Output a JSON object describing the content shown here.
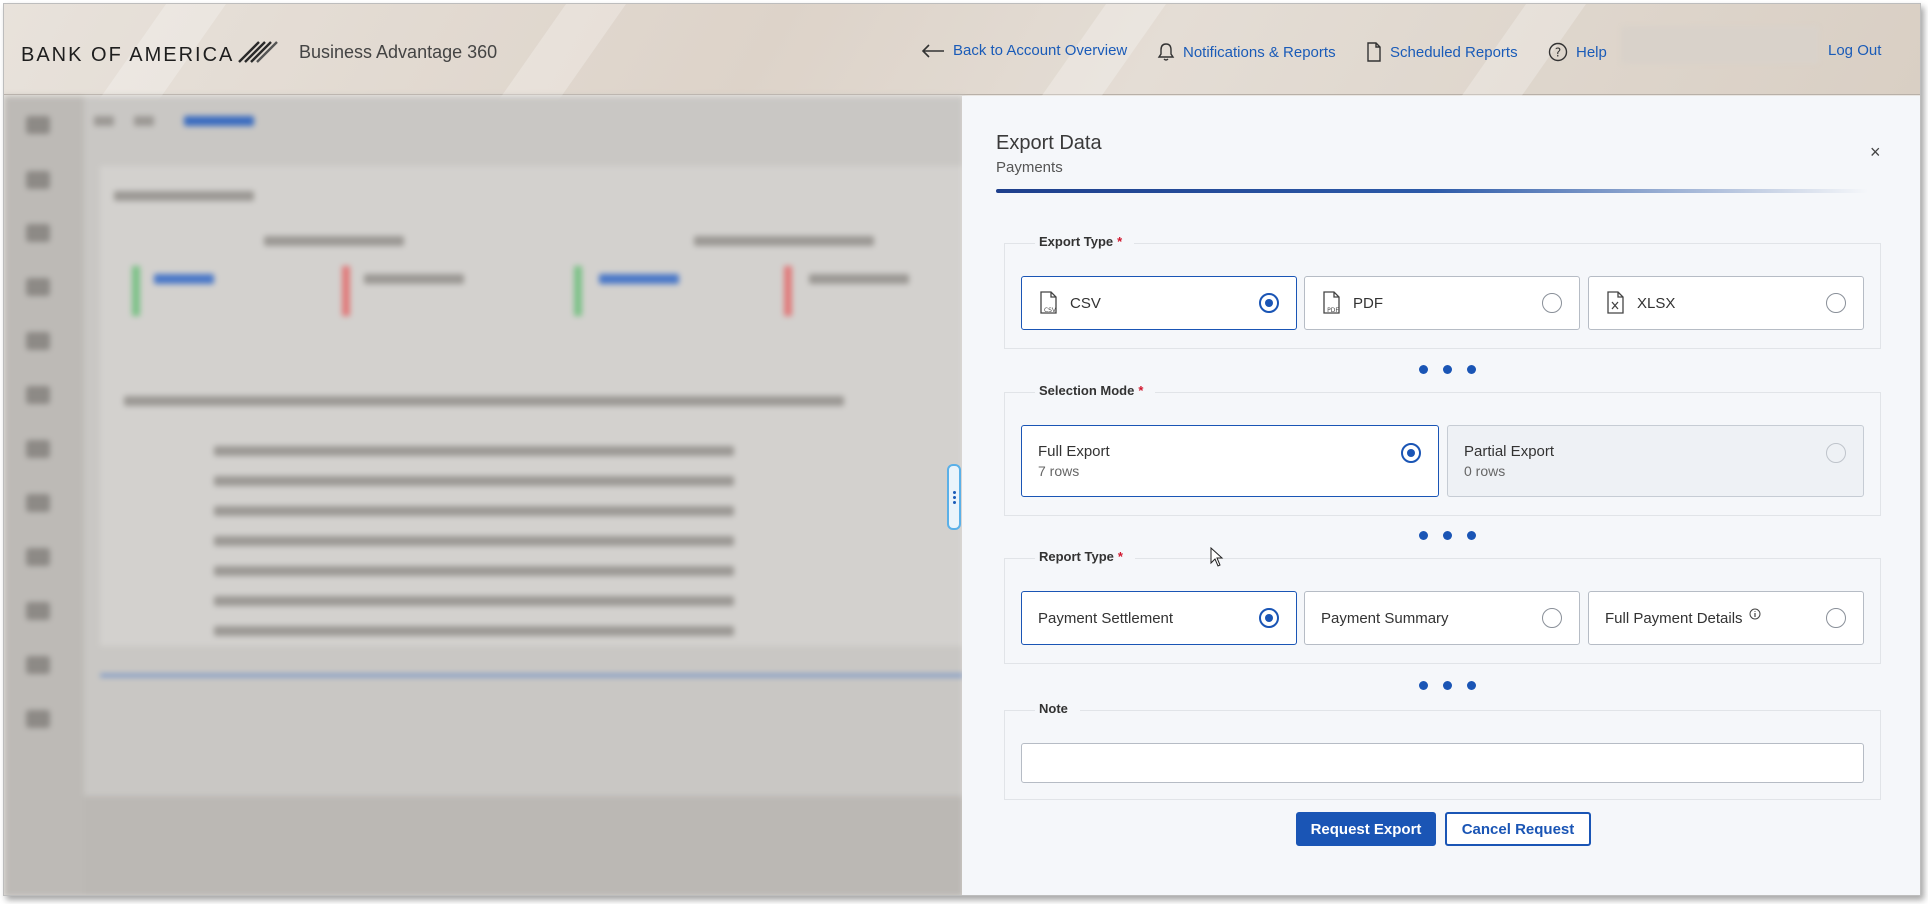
{
  "header": {
    "logo_text": "BANK OF AMERICA",
    "product_name": "Business Advantage 360",
    "nav": {
      "back": "Back to Account Overview",
      "notifications": "Notifications & Reports",
      "scheduled": "Scheduled Reports",
      "help": "Help",
      "logout": "Log Out"
    }
  },
  "drawer": {
    "title": "Export Data",
    "subtitle": "Payments",
    "close_label": "×",
    "export_type": {
      "label": "Export Type",
      "required_mark": "*",
      "options": [
        {
          "label": "CSV",
          "selected": true,
          "icon": "csv-file-icon"
        },
        {
          "label": "PDF",
          "selected": false,
          "icon": "pdf-file-icon"
        },
        {
          "label": "XLSX",
          "selected": false,
          "icon": "xlsx-file-icon"
        }
      ]
    },
    "selection_mode": {
      "label": "Selection Mode",
      "required_mark": "*",
      "options": [
        {
          "label": "Full Export",
          "detail": "7 rows",
          "selected": true,
          "disabled": false
        },
        {
          "label": "Partial Export",
          "detail": "0 rows",
          "selected": false,
          "disabled": true
        }
      ]
    },
    "report_type": {
      "label": "Report Type",
      "required_mark": "*",
      "options": [
        {
          "label": "Payment Settlement",
          "selected": true
        },
        {
          "label": "Payment Summary",
          "selected": false
        },
        {
          "label": "Full Payment Details",
          "selected": false,
          "info_icon": "info-icon"
        }
      ]
    },
    "note": {
      "label": "Note",
      "value": "",
      "placeholder": ""
    },
    "buttons": {
      "request": "Request Export",
      "cancel": "Cancel Request"
    }
  },
  "colors": {
    "accent": "#1a55b5",
    "required": "#d1172e",
    "link": "#1a5bb8"
  }
}
